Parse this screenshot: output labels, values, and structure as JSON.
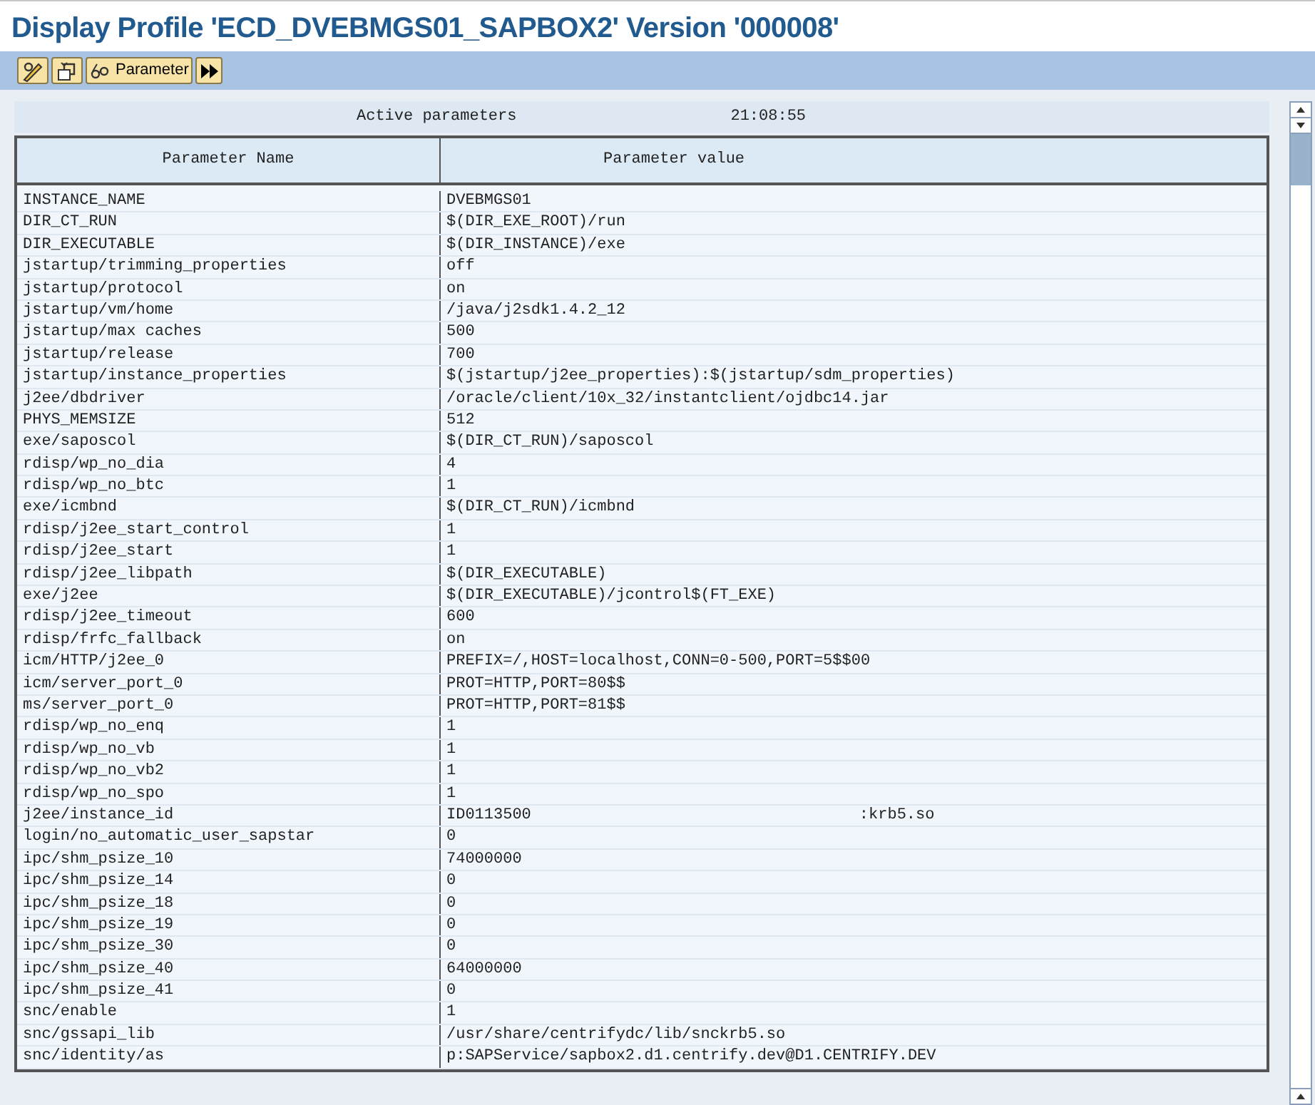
{
  "title": "Display Profile 'ECD_DVEBMGS01_SAPBOX2' Version '000008'",
  "toolbar": [
    {
      "kind": "edit"
    },
    {
      "kind": "switch"
    },
    {
      "kind": "param",
      "label": "Parameter"
    },
    {
      "kind": "next"
    }
  ],
  "info": {
    "label": "Active parameters",
    "time": "21:08:55"
  },
  "table": {
    "columns": [
      "Parameter Name",
      "Parameter value"
    ],
    "rows": [
      {
        "name": "INSTANCE_NAME",
        "value": "DVEBMGS01"
      },
      {
        "name": "DIR_CT_RUN",
        "value": "$(DIR_EXE_ROOT)/run"
      },
      {
        "name": "DIR_EXECUTABLE",
        "value": "$(DIR_INSTANCE)/exe"
      },
      {
        "name": "jstartup/trimming_properties",
        "value": "off"
      },
      {
        "name": "jstartup/protocol",
        "value": "on"
      },
      {
        "name": "jstartup/vm/home",
        "value": "/java/j2sdk1.4.2_12"
      },
      {
        "name": "jstartup/max caches",
        "value": "500"
      },
      {
        "name": "jstartup/release",
        "value": "700"
      },
      {
        "name": "jstartup/instance_properties",
        "value": "$(jstartup/j2ee_properties):$(jstartup/sdm_properties)"
      },
      {
        "name": "j2ee/dbdriver",
        "value": "/oracle/client/10x_32/instantclient/ojdbc14.jar"
      },
      {
        "name": "PHYS_MEMSIZE",
        "value": "512"
      },
      {
        "name": "exe/saposcol",
        "value": "$(DIR_CT_RUN)/saposcol"
      },
      {
        "name": "rdisp/wp_no_dia",
        "value": "4"
      },
      {
        "name": "rdisp/wp_no_btc",
        "value": "1"
      },
      {
        "name": "exe/icmbnd",
        "value": "$(DIR_CT_RUN)/icmbnd"
      },
      {
        "name": "rdisp/j2ee_start_control",
        "value": "1"
      },
      {
        "name": "rdisp/j2ee_start",
        "value": "1"
      },
      {
        "name": "rdisp/j2ee_libpath",
        "value": "$(DIR_EXECUTABLE)"
      },
      {
        "name": "exe/j2ee",
        "value": "$(DIR_EXECUTABLE)/jcontrol$(FT_EXE)"
      },
      {
        "name": "rdisp/j2ee_timeout",
        "value": "600"
      },
      {
        "name": "rdisp/frfc_fallback",
        "value": "on"
      },
      {
        "name": "icm/HTTP/j2ee_0",
        "value": "PREFIX=/,HOST=localhost,CONN=0-500,PORT=5$$00"
      },
      {
        "name": "icm/server_port_0",
        "value": "PROT=HTTP,PORT=80$$"
      },
      {
        "name": "ms/server_port_0",
        "value": "PROT=HTTP,PORT=81$$"
      },
      {
        "name": "rdisp/wp_no_enq",
        "value": "1"
      },
      {
        "name": "rdisp/wp_no_vb",
        "value": "1"
      },
      {
        "name": "rdisp/wp_no_vb2",
        "value": "1"
      },
      {
        "name": "rdisp/wp_no_spo",
        "value": "1"
      },
      {
        "name": "j2ee/instance_id",
        "value": "ID0113500",
        "note": ":krb5.so"
      },
      {
        "name": "login/no_automatic_user_sapstar",
        "value": "0"
      },
      {
        "name": "ipc/shm_psize_10",
        "value": "74000000"
      },
      {
        "name": "ipc/shm_psize_14",
        "value": "0"
      },
      {
        "name": "ipc/shm_psize_18",
        "value": "0"
      },
      {
        "name": "ipc/shm_psize_19",
        "value": "0"
      },
      {
        "name": "ipc/shm_psize_30",
        "value": "0"
      },
      {
        "name": "ipc/shm_psize_40",
        "value": "64000000"
      },
      {
        "name": "ipc/shm_psize_41",
        "value": "0"
      },
      {
        "name": "snc/enable",
        "value": "1"
      },
      {
        "name": "snc/gssapi_lib",
        "value": "/usr/share/centrifydc/lib/snckrb5.so"
      },
      {
        "name": "snc/identity/as",
        "value": "p:SAPService/sapbox2.d1.centrify.dev@D1.CENTRIFY.DEV"
      }
    ]
  }
}
